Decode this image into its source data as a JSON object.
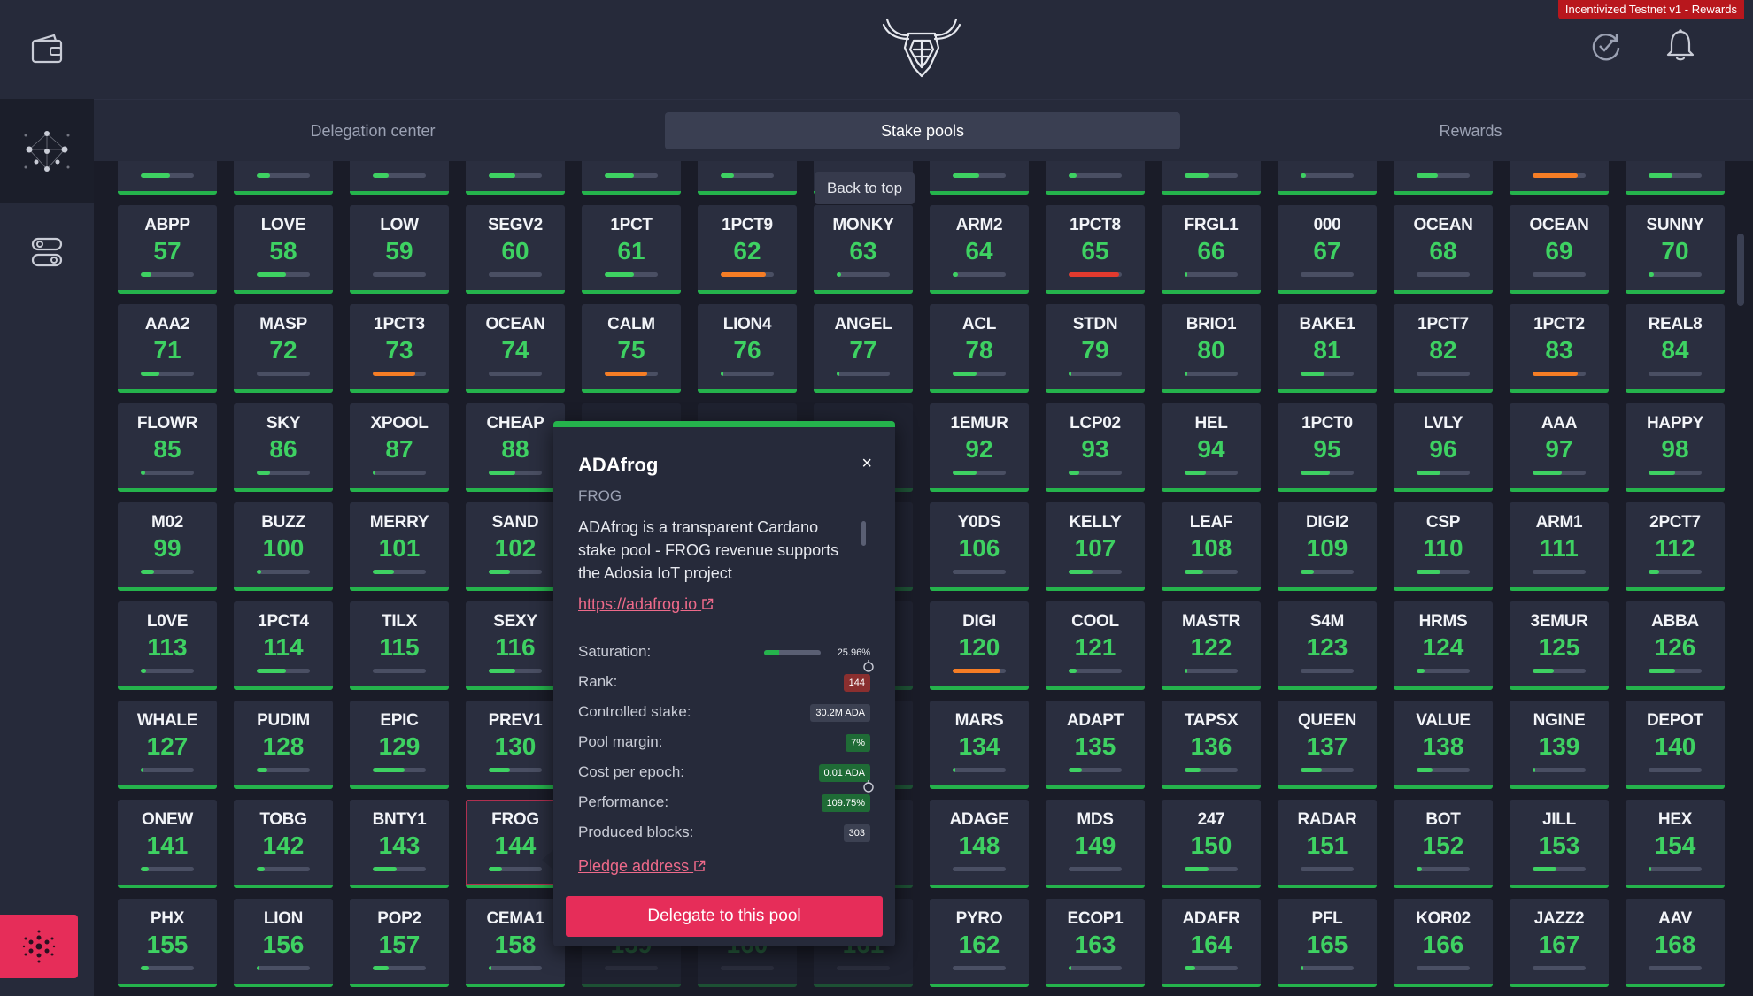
{
  "badge": "Incentivized Testnet v1 - Rewards",
  "tabs": [
    {
      "label": "Delegation center",
      "active": false
    },
    {
      "label": "Stake pools",
      "active": true
    },
    {
      "label": "Rewards",
      "active": false
    }
  ],
  "back_to_top": "Back to top",
  "colors": {
    "green": "#3ed162",
    "orange": "#f57d25",
    "red": "#e23a2e",
    "accent": "#e62d59",
    "badge": "#b8171d"
  },
  "tile_rows": [
    [
      {
        "ticker": "ABPP",
        "rank": "57",
        "sat": 0.2,
        "color": "green"
      },
      {
        "ticker": "LOVE",
        "rank": "58",
        "sat": 0.55,
        "color": "green"
      },
      {
        "ticker": "LOW",
        "rank": "59",
        "sat": 0.0,
        "color": "green"
      },
      {
        "ticker": "SEGV2",
        "rank": "60",
        "sat": 0.0,
        "color": "green"
      },
      {
        "ticker": "1PCT",
        "rank": "61",
        "sat": 0.55,
        "color": "green"
      },
      {
        "ticker": "1PCT9",
        "rank": "62",
        "sat": 0.85,
        "color": "orange"
      },
      {
        "ticker": "MONKY",
        "rank": "63",
        "sat": 0.08,
        "color": "green"
      },
      {
        "ticker": "ARM2",
        "rank": "64",
        "sat": 0.1,
        "color": "green"
      },
      {
        "ticker": "1PCT8",
        "rank": "65",
        "sat": 0.95,
        "color": "red"
      },
      {
        "ticker": "FRGL1",
        "rank": "66",
        "sat": 0.05,
        "color": "green"
      },
      {
        "ticker": "000",
        "rank": "67",
        "sat": 0.0,
        "color": "green"
      },
      {
        "ticker": "OCEAN",
        "rank": "68",
        "sat": 0.0,
        "color": "green"
      },
      {
        "ticker": "OCEAN",
        "rank": "69",
        "sat": 0.0,
        "color": "green"
      },
      {
        "ticker": "SUNNY",
        "rank": "70",
        "sat": 0.1,
        "color": "green"
      }
    ],
    [
      {
        "ticker": "AAA2",
        "rank": "71",
        "sat": 0.35,
        "color": "green"
      },
      {
        "ticker": "MASP",
        "rank": "72",
        "sat": 0.0,
        "color": "green"
      },
      {
        "ticker": "1PCT3",
        "rank": "73",
        "sat": 0.8,
        "color": "orange"
      },
      {
        "ticker": "OCEAN",
        "rank": "74",
        "sat": 0.0,
        "color": "green"
      },
      {
        "ticker": "CALM",
        "rank": "75",
        "sat": 0.8,
        "color": "orange"
      },
      {
        "ticker": "LION4",
        "rank": "76",
        "sat": 0.05,
        "color": "green"
      },
      {
        "ticker": "ANGEL",
        "rank": "77",
        "sat": 0.05,
        "color": "green"
      },
      {
        "ticker": "ACL",
        "rank": "78",
        "sat": 0.45,
        "color": "green"
      },
      {
        "ticker": "STDN",
        "rank": "79",
        "sat": 0.05,
        "color": "green"
      },
      {
        "ticker": "BRIO1",
        "rank": "80",
        "sat": 0.05,
        "color": "green"
      },
      {
        "ticker": "BAKE1",
        "rank": "81",
        "sat": 0.45,
        "color": "green"
      },
      {
        "ticker": "1PCT7",
        "rank": "82",
        "sat": 0.0,
        "color": "green"
      },
      {
        "ticker": "1PCT2",
        "rank": "83",
        "sat": 0.85,
        "color": "orange"
      },
      {
        "ticker": "REAL8",
        "rank": "84",
        "sat": 0.0,
        "color": "green"
      }
    ],
    [
      {
        "ticker": "FLOWR",
        "rank": "85",
        "sat": 0.08,
        "color": "green"
      },
      {
        "ticker": "SKY",
        "rank": "86",
        "sat": 0.25,
        "color": "green"
      },
      {
        "ticker": "XPOOL",
        "rank": "87",
        "sat": 0.05,
        "color": "green"
      },
      {
        "ticker": "CHEAP",
        "rank": "88",
        "sat": 0.5,
        "color": "green"
      },
      {
        "ticker": "",
        "rank": "",
        "sat": 0.0,
        "color": "green",
        "dim": true
      },
      {
        "ticker": "",
        "rank": "",
        "sat": 0.0,
        "color": "green",
        "dim": true
      },
      {
        "ticker": "",
        "rank": "",
        "sat": 0.0,
        "color": "green",
        "dim": true
      },
      {
        "ticker": "1EMUR",
        "rank": "92",
        "sat": 0.45,
        "color": "green"
      },
      {
        "ticker": "LCP02",
        "rank": "93",
        "sat": 0.2,
        "color": "green"
      },
      {
        "ticker": "HEL",
        "rank": "94",
        "sat": 0.4,
        "color": "green"
      },
      {
        "ticker": "1PCT0",
        "rank": "95",
        "sat": 0.55,
        "color": "green"
      },
      {
        "ticker": "LVLY",
        "rank": "96",
        "sat": 0.45,
        "color": "green"
      },
      {
        "ticker": "AAA",
        "rank": "97",
        "sat": 0.55,
        "color": "green"
      },
      {
        "ticker": "HAPPY",
        "rank": "98",
        "sat": 0.5,
        "color": "green"
      }
    ],
    [
      {
        "ticker": "M02",
        "rank": "99",
        "sat": 0.25,
        "color": "green"
      },
      {
        "ticker": "BUZZ",
        "rank": "100",
        "sat": 0.08,
        "color": "green"
      },
      {
        "ticker": "MERRY",
        "rank": "101",
        "sat": 0.4,
        "color": "green"
      },
      {
        "ticker": "SAND",
        "rank": "102",
        "sat": 0.4,
        "color": "green"
      },
      {
        "ticker": "",
        "rank": "",
        "sat": 0.0,
        "color": "green",
        "dim": true
      },
      {
        "ticker": "",
        "rank": "",
        "sat": 0.0,
        "color": "green",
        "dim": true
      },
      {
        "ticker": "",
        "rank": "",
        "sat": 0.0,
        "color": "green",
        "dim": true
      },
      {
        "ticker": "Y0DS",
        "rank": "106",
        "sat": 0.0,
        "color": "green"
      },
      {
        "ticker": "KELLY",
        "rank": "107",
        "sat": 0.45,
        "color": "green"
      },
      {
        "ticker": "LEAF",
        "rank": "108",
        "sat": 0.35,
        "color": "green"
      },
      {
        "ticker": "DIGI2",
        "rank": "109",
        "sat": 0.25,
        "color": "green"
      },
      {
        "ticker": "CSP",
        "rank": "110",
        "sat": 0.45,
        "color": "green"
      },
      {
        "ticker": "ARM1",
        "rank": "111",
        "sat": 0.0,
        "color": "green"
      },
      {
        "ticker": "2PCT7",
        "rank": "112",
        "sat": 0.2,
        "color": "green"
      }
    ],
    [
      {
        "ticker": "L0VE",
        "rank": "113",
        "sat": 0.1,
        "color": "green"
      },
      {
        "ticker": "1PCT4",
        "rank": "114",
        "sat": 0.55,
        "color": "green"
      },
      {
        "ticker": "TILX",
        "rank": "115",
        "sat": 0.0,
        "color": "green"
      },
      {
        "ticker": "SEXY",
        "rank": "116",
        "sat": 0.5,
        "color": "green"
      },
      {
        "ticker": "",
        "rank": "",
        "sat": 0.0,
        "color": "green",
        "dim": true
      },
      {
        "ticker": "",
        "rank": "",
        "sat": 0.0,
        "color": "green",
        "dim": true
      },
      {
        "ticker": "",
        "rank": "",
        "sat": 0.0,
        "color": "green",
        "dim": true
      },
      {
        "ticker": "DIGI",
        "rank": "120",
        "sat": 0.9,
        "color": "orange"
      },
      {
        "ticker": "COOL",
        "rank": "121",
        "sat": 0.15,
        "color": "green"
      },
      {
        "ticker": "MASTR",
        "rank": "122",
        "sat": 0.05,
        "color": "green"
      },
      {
        "ticker": "S4M",
        "rank": "123",
        "sat": 0.0,
        "color": "green"
      },
      {
        "ticker": "HRMS",
        "rank": "124",
        "sat": 0.15,
        "color": "green"
      },
      {
        "ticker": "3EMUR",
        "rank": "125",
        "sat": 0.4,
        "color": "green"
      },
      {
        "ticker": "ABBA",
        "rank": "126",
        "sat": 0.5,
        "color": "green"
      }
    ],
    [
      {
        "ticker": "WHALE",
        "rank": "127",
        "sat": 0.05,
        "color": "green"
      },
      {
        "ticker": "PUDIM",
        "rank": "128",
        "sat": 0.2,
        "color": "green"
      },
      {
        "ticker": "EPIC",
        "rank": "129",
        "sat": 0.6,
        "color": "green"
      },
      {
        "ticker": "PREV1",
        "rank": "130",
        "sat": 0.4,
        "color": "green"
      },
      {
        "ticker": "",
        "rank": "",
        "sat": 0.0,
        "color": "green",
        "dim": true
      },
      {
        "ticker": "",
        "rank": "",
        "sat": 0.0,
        "color": "green",
        "dim": true
      },
      {
        "ticker": "",
        "rank": "",
        "sat": 0.0,
        "color": "green",
        "dim": true
      },
      {
        "ticker": "MARS",
        "rank": "134",
        "sat": 0.05,
        "color": "green"
      },
      {
        "ticker": "ADAPT",
        "rank": "135",
        "sat": 0.25,
        "color": "green"
      },
      {
        "ticker": "TAPSX",
        "rank": "136",
        "sat": 0.3,
        "color": "green"
      },
      {
        "ticker": "QUEEN",
        "rank": "137",
        "sat": 0.4,
        "color": "green"
      },
      {
        "ticker": "VALUE",
        "rank": "138",
        "sat": 0.3,
        "color": "green"
      },
      {
        "ticker": "NGINE",
        "rank": "139",
        "sat": 0.05,
        "color": "green"
      },
      {
        "ticker": "DEPOT",
        "rank": "140",
        "sat": 0.0,
        "color": "green"
      }
    ],
    [
      {
        "ticker": "ONEW",
        "rank": "141",
        "sat": 0.15,
        "color": "green"
      },
      {
        "ticker": "TOBG",
        "rank": "142",
        "sat": 0.15,
        "color": "green"
      },
      {
        "ticker": "BNTY1",
        "rank": "143",
        "sat": 0.45,
        "color": "green"
      },
      {
        "ticker": "FROG",
        "rank": "144",
        "sat": 0.25,
        "color": "green",
        "selected": true
      },
      {
        "ticker": "",
        "rank": "",
        "sat": 0.0,
        "color": "green",
        "dim": true
      },
      {
        "ticker": "",
        "rank": "",
        "sat": 0.0,
        "color": "green",
        "dim": true
      },
      {
        "ticker": "",
        "rank": "",
        "sat": 0.0,
        "color": "green",
        "dim": true
      },
      {
        "ticker": "ADAGE",
        "rank": "148",
        "sat": 0.0,
        "color": "green"
      },
      {
        "ticker": "MDS",
        "rank": "149",
        "sat": 0.0,
        "color": "green"
      },
      {
        "ticker": "247",
        "rank": "150",
        "sat": 0.45,
        "color": "green"
      },
      {
        "ticker": "RADAR",
        "rank": "151",
        "sat": 0.0,
        "color": "green"
      },
      {
        "ticker": "BOT",
        "rank": "152",
        "sat": 0.1,
        "color": "green"
      },
      {
        "ticker": "JILL",
        "rank": "153",
        "sat": 0.45,
        "color": "green"
      },
      {
        "ticker": "HEX",
        "rank": "154",
        "sat": 0.05,
        "color": "green"
      }
    ],
    [
      {
        "ticker": "PHX",
        "rank": "155",
        "sat": 0.15,
        "color": "green"
      },
      {
        "ticker": "LION",
        "rank": "156",
        "sat": 0.05,
        "color": "green"
      },
      {
        "ticker": "POP2",
        "rank": "157",
        "sat": 0.3,
        "color": "green"
      },
      {
        "ticker": "CEMA1",
        "rank": "158",
        "sat": 0.05,
        "color": "green"
      },
      {
        "ticker": "",
        "rank": "159",
        "sat": 0.0,
        "color": "green",
        "dim": true
      },
      {
        "ticker": "",
        "rank": "160",
        "sat": 0.0,
        "color": "green",
        "dim": true
      },
      {
        "ticker": "",
        "rank": "161",
        "sat": 0.0,
        "color": "green",
        "dim": true
      },
      {
        "ticker": "PYRO",
        "rank": "162",
        "sat": 0.0,
        "color": "green"
      },
      {
        "ticker": "ECOP1",
        "rank": "163",
        "sat": 0.05,
        "color": "green"
      },
      {
        "ticker": "ADAFR",
        "rank": "164",
        "sat": 0.2,
        "color": "green"
      },
      {
        "ticker": "PFL",
        "rank": "165",
        "sat": 0.05,
        "color": "green"
      },
      {
        "ticker": "KOR02",
        "rank": "166",
        "sat": 0.0,
        "color": "green"
      },
      {
        "ticker": "JAZZ2",
        "rank": "167",
        "sat": 0.0,
        "color": "green"
      },
      {
        "ticker": "AAV",
        "rank": "168",
        "sat": 0.0,
        "color": "green"
      }
    ]
  ],
  "top_partial_bars": [
    0.55,
    0.25,
    0.3,
    0.5,
    0.55,
    0.25,
    0.0,
    0.5,
    0.15,
    0.45,
    0.1,
    0.4,
    0.85,
    0.45
  ],
  "top_partial_colors": [
    "green",
    "green",
    "green",
    "green",
    "green",
    "green",
    "green",
    "green",
    "green",
    "green",
    "green",
    "green",
    "orange",
    "green"
  ],
  "popup": {
    "name": "ADAfrog",
    "close": "×",
    "ticker": "FROG",
    "description": "ADAfrog is a transparent Cardano stake pool - FROG revenue supports the Adosia IoT project",
    "url": "https://adafrog.io",
    "saturation_label": "Saturation:",
    "saturation_value": "25.96%",
    "saturation": 0.2596,
    "rank_label": "Rank:",
    "rank_value": "144",
    "stake_label": "Controlled stake:",
    "stake_value": "30.2M ADA",
    "margin_label": "Pool margin:",
    "margin_value": "7%",
    "cost_label": "Cost per epoch:",
    "cost_value": "0.01 ADA",
    "performance_label": "Performance:",
    "performance_value": "109.75%",
    "blocks_label": "Produced blocks:",
    "blocks_value": "303",
    "pledge": "Pledge address",
    "delegate": "Delegate to this pool"
  }
}
